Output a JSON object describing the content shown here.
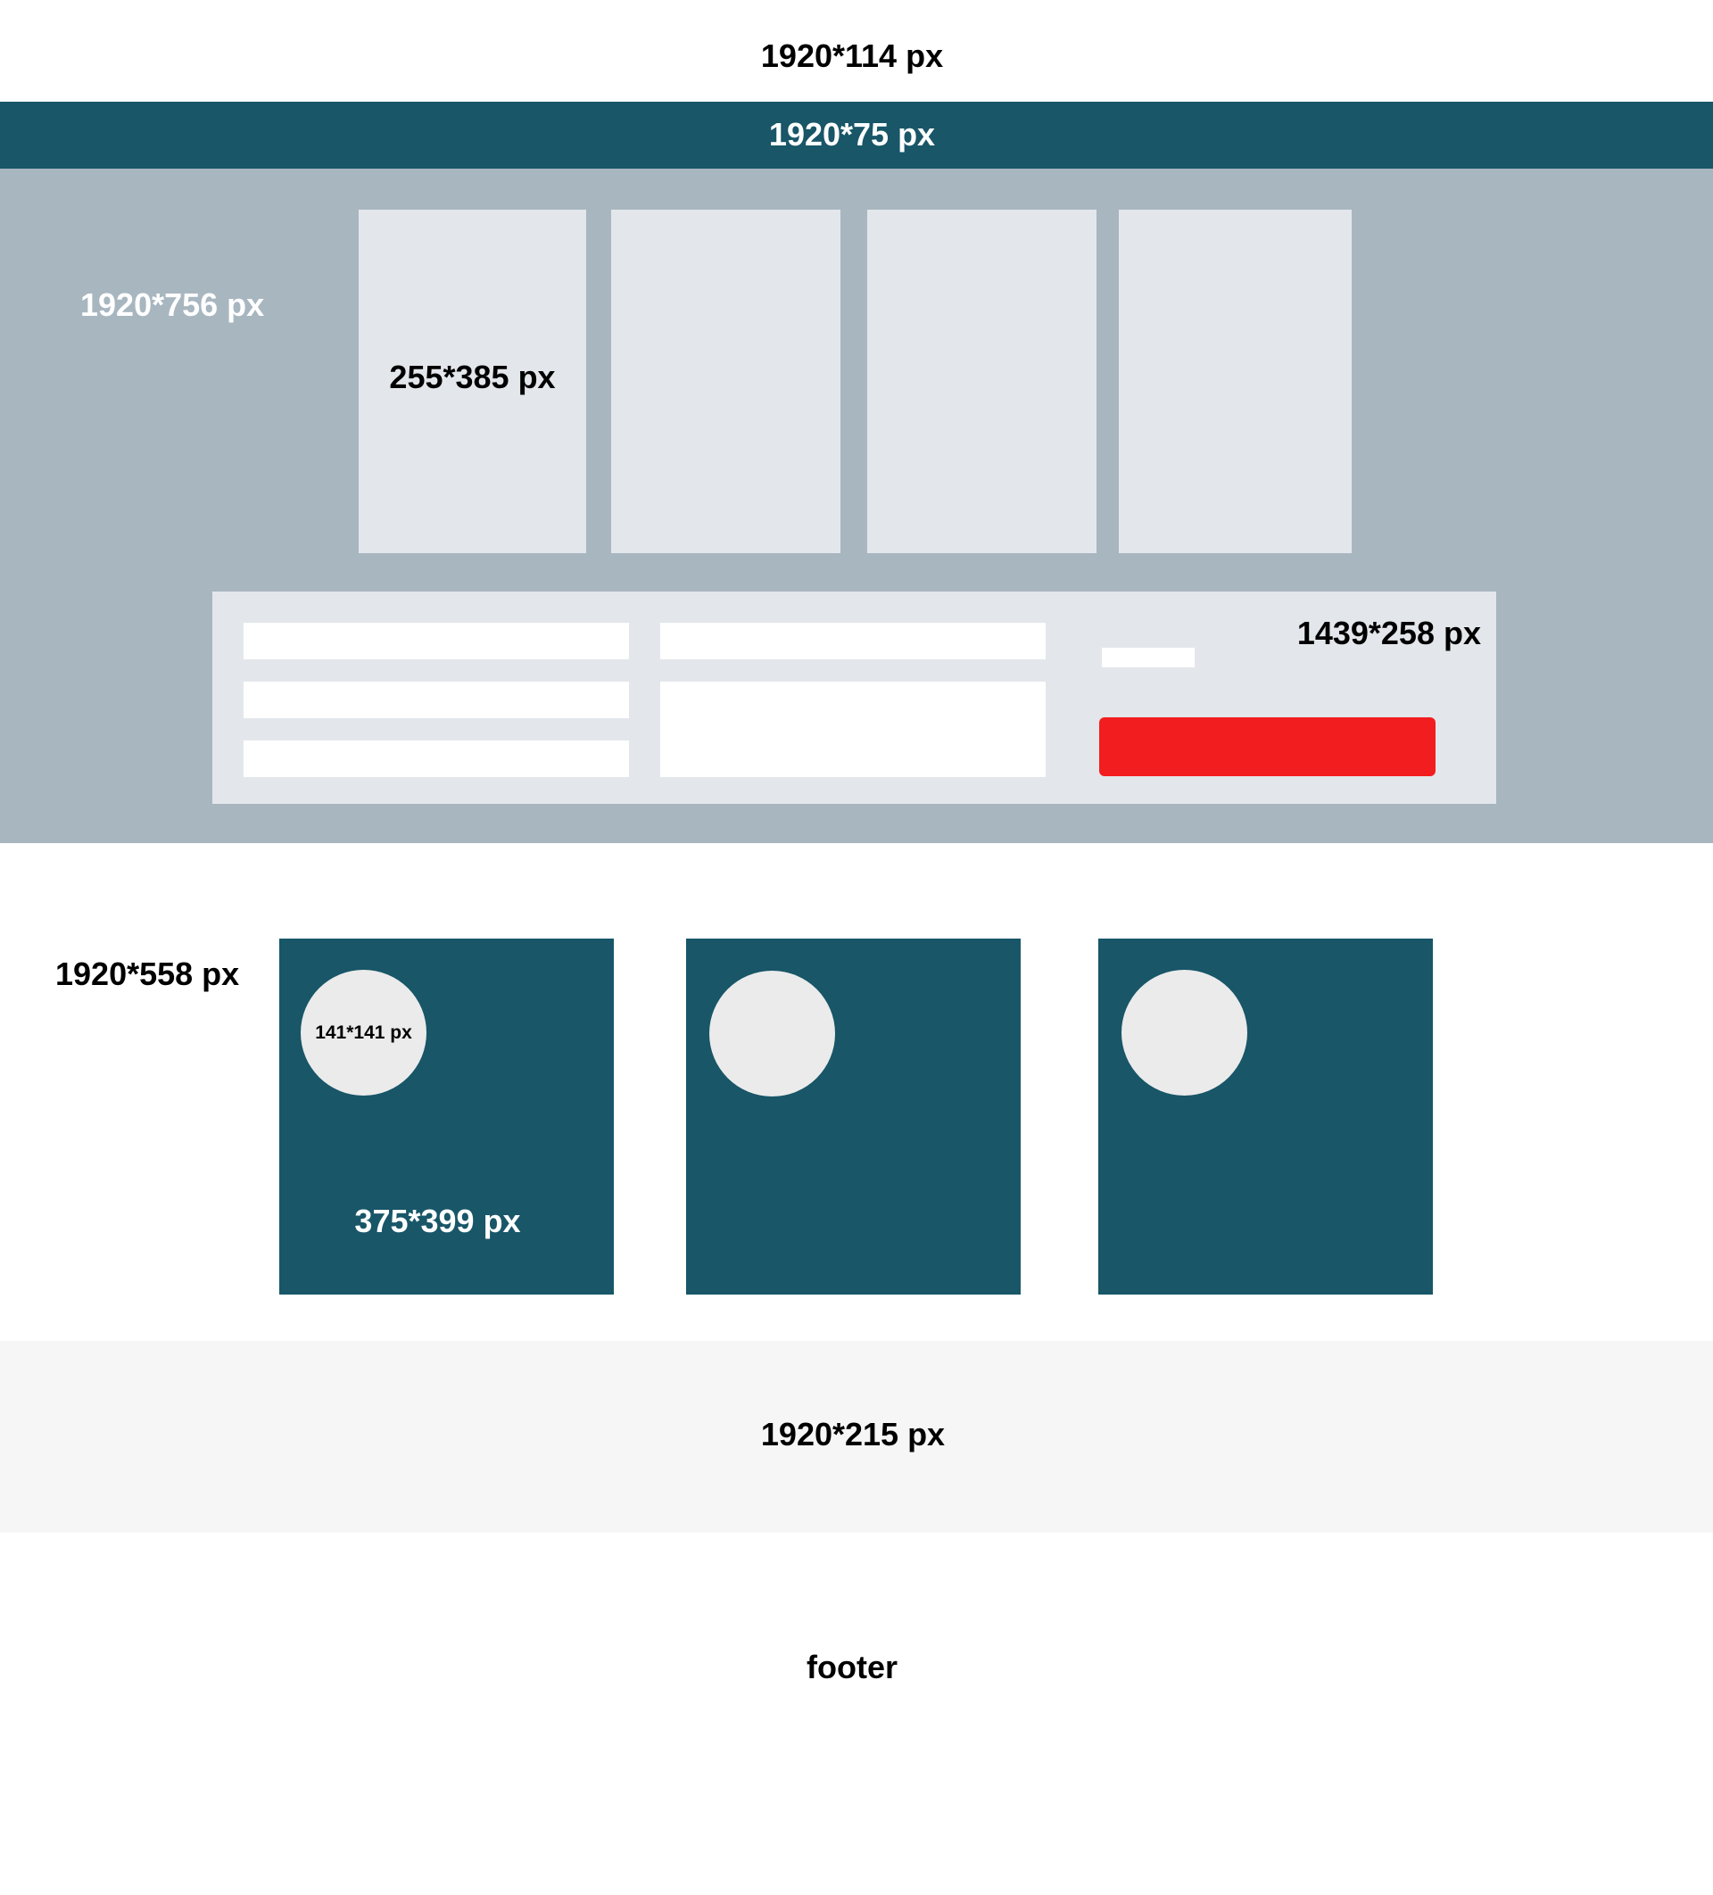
{
  "header": {
    "label": "1920*114 px"
  },
  "nav": {
    "label": "1920*75 px",
    "color": "#185668"
  },
  "hero": {
    "label": "1920*756 px",
    "color": "#a8b6c0",
    "cards": [
      {
        "label": "255*385 px"
      },
      {
        "label": ""
      },
      {
        "label": ""
      },
      {
        "label": ""
      }
    ],
    "form": {
      "label": "1439*258 px",
      "button_color": "#f21d1f"
    }
  },
  "features": {
    "label": "1920*558 px",
    "cards": [
      {
        "label": "375*399 px",
        "circle_label": "141*141 px"
      },
      {
        "label": "",
        "circle_label": ""
      },
      {
        "label": "",
        "circle_label": ""
      }
    ]
  },
  "band": {
    "label": "1920*215 px",
    "color": "#f6f6f6"
  },
  "footer": {
    "label": "footer"
  }
}
